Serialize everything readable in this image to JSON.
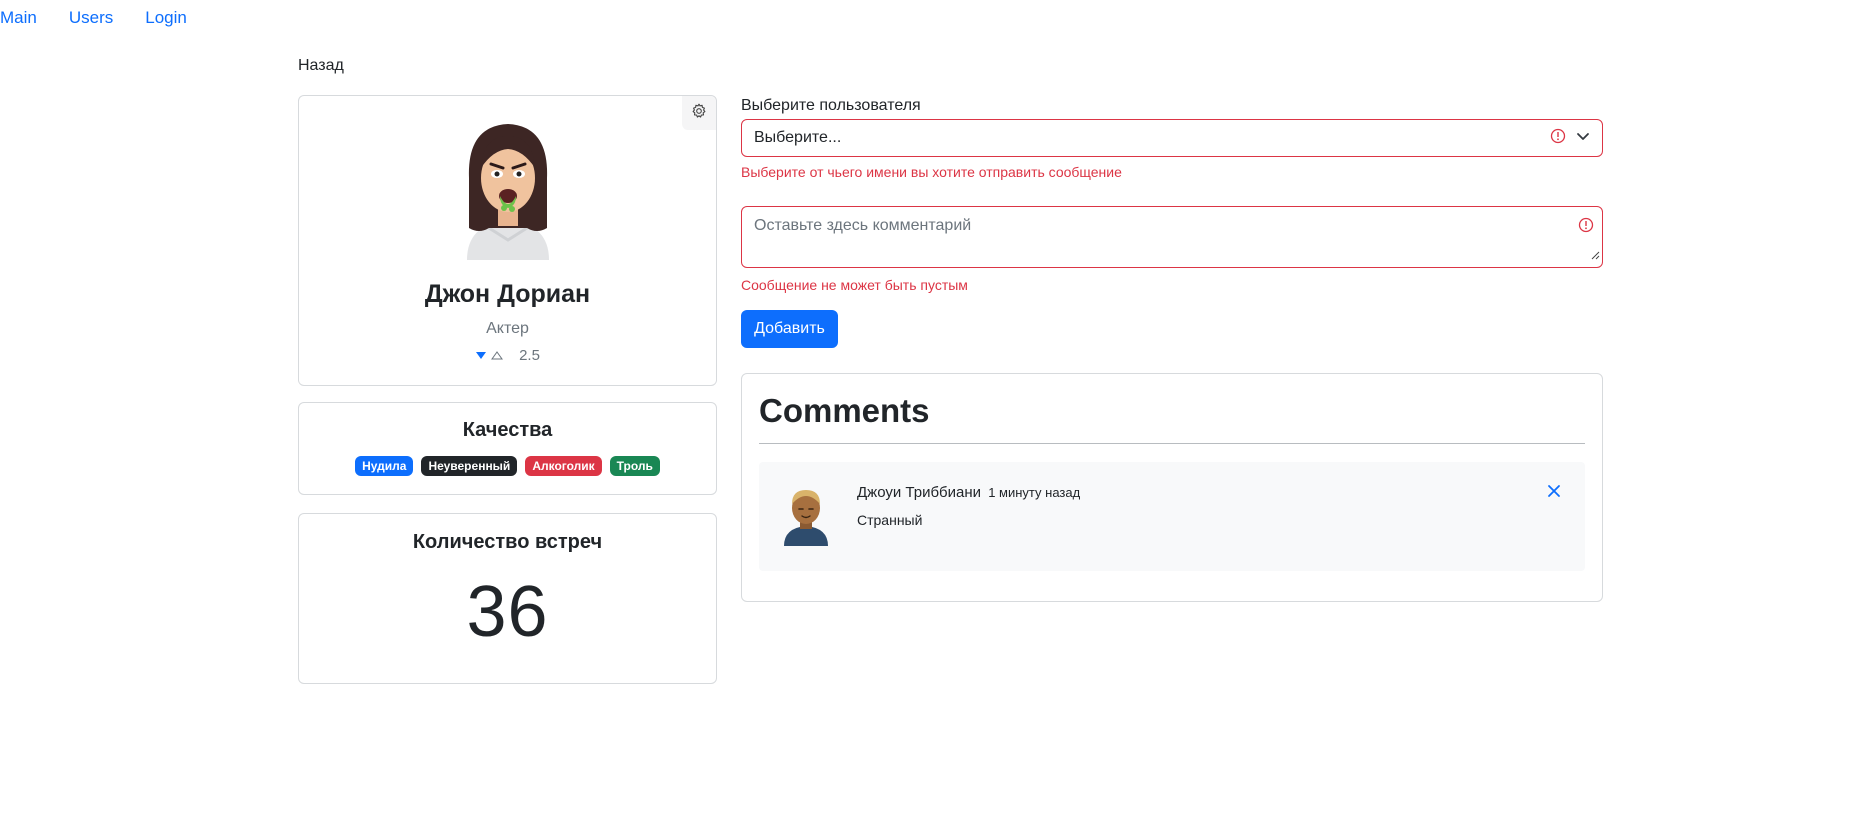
{
  "nav": {
    "items": [
      "Main",
      "Users",
      "Login"
    ]
  },
  "back_label": "Назад",
  "profile": {
    "name": "Джон Дориан",
    "profession": "Актер",
    "rating": "2.5"
  },
  "qualities": {
    "title": "Качества",
    "badges": [
      {
        "label": "Нудила",
        "color": "#0d6efd"
      },
      {
        "label": "Неуверенный",
        "color": "#212529"
      },
      {
        "label": "Алкоголик",
        "color": "#dc3545"
      },
      {
        "label": "Троль",
        "color": "#198754"
      }
    ]
  },
  "meetings": {
    "title": "Количество встреч",
    "count": "36"
  },
  "form": {
    "select_label": "Выберите пользователя",
    "select_value": "Выберите...",
    "select_error": "Выберите от чьего имени вы хотите отправить сообщение",
    "comment_placeholder": "Оставьте здесь комментарий",
    "comment_error": "Сообщение не может быть пустым",
    "submit_label": "Добавить"
  },
  "comments": {
    "title": "Comments",
    "items": [
      {
        "author": "Джоуи Триббиани",
        "time": "1 минуту назад",
        "text": "Странный"
      }
    ]
  },
  "colors": {
    "primary": "#0d6efd",
    "danger": "#dc3545",
    "success": "#198754",
    "dark": "#212529",
    "muted": "#6c757d"
  },
  "icons": [
    "gear-icon",
    "caret-down-filled-icon",
    "caret-up-outline-icon",
    "exclamation-circle-icon",
    "chevron-down-icon",
    "resize-handle-icon",
    "close-icon"
  ]
}
